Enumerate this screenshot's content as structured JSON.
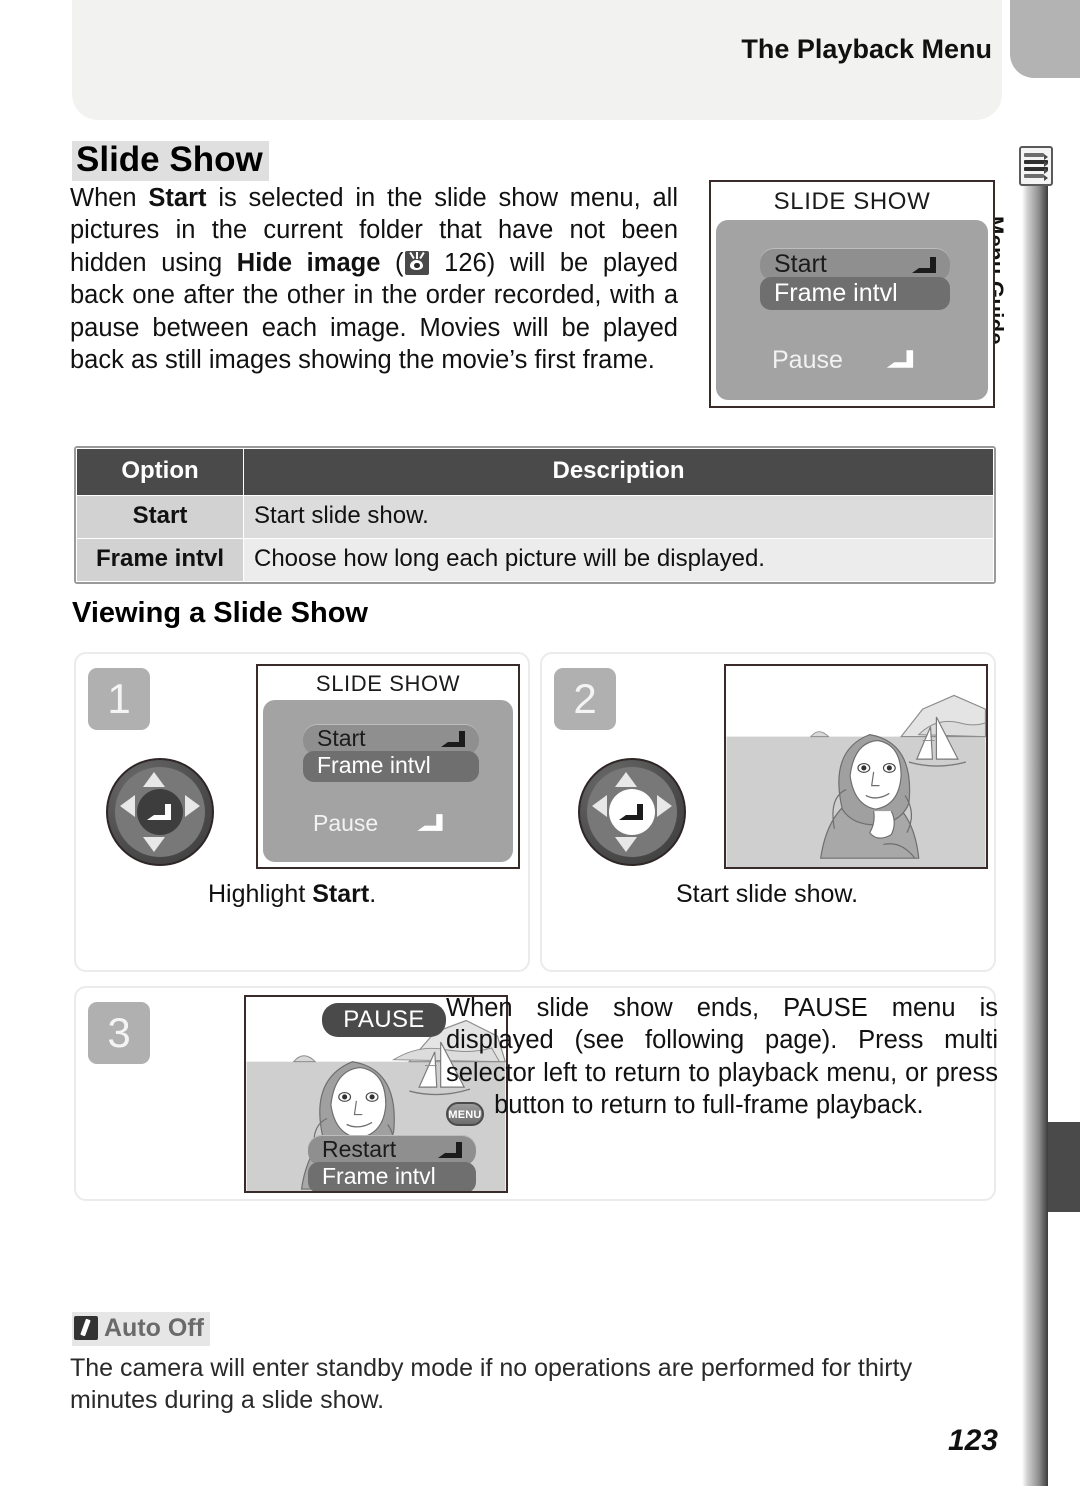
{
  "header": {
    "title": "The Playback Menu"
  },
  "sidebar": {
    "label": "Menu Guide",
    "icon": "menu-list-icon"
  },
  "section": {
    "heading": "Slide Show",
    "intro_parts": {
      "p1": "When ",
      "b1": "Start",
      "p2": " is selected in the slide show menu, all pictures in the current folder that have not been hidden using ",
      "b2": "Hide image",
      "p3": " (",
      "page_ref": "126",
      "p4": ") will be played back one after the other in the order recorded, with a pause between each image.  Movies will be played back as still images showing the movie’s first frame."
    }
  },
  "lcd_top": {
    "title": "SLIDE SHOW",
    "items": [
      {
        "label": "Start",
        "state": "highlighted",
        "glyph": "enter-icon"
      },
      {
        "label": "Frame intvl",
        "state": "selected"
      }
    ],
    "pause_label": "Pause",
    "pause_glyph": "enter-icon"
  },
  "table": {
    "headers": [
      "Option",
      "Description"
    ],
    "rows": [
      {
        "option": "Start",
        "description": "Start slide show."
      },
      {
        "option": "Frame intvl",
        "description": "Choose how long each picture will be displayed."
      }
    ]
  },
  "subsection": {
    "heading": "Viewing a Slide Show"
  },
  "steps": [
    {
      "number": "1",
      "caption_plain": "Highlight ",
      "caption_bold": "Start",
      "caption_tail": ".",
      "lcd": {
        "title": "SLIDE SHOW",
        "items": [
          {
            "label": "Start",
            "state": "highlighted",
            "glyph": "enter-icon"
          },
          {
            "label": "Frame intvl",
            "state": "selected"
          }
        ],
        "pause_label": "Pause",
        "pause_glyph": "enter-icon"
      },
      "control": "multi-selector"
    },
    {
      "number": "2",
      "caption_plain": "Start slide show.",
      "caption_bold": "",
      "caption_tail": "",
      "control": "multi-selector"
    },
    {
      "number": "3",
      "lcd": {
        "badge": "PAUSE",
        "items": [
          {
            "label": "Restart",
            "state": "highlighted",
            "glyph": "enter-icon"
          },
          {
            "label": "Frame intvl",
            "state": "selected"
          }
        ]
      },
      "body_parts": {
        "t1": "When slide show ends, PAUSE menu is displayed (see following page).  Press multi selector left to return to playback menu, or press ",
        "btn": "MENU",
        "t2": " button to return to full-frame playback."
      }
    }
  ],
  "note": {
    "title": "Auto Off",
    "icon": "pencil-icon",
    "body": "The camera will enter standby mode if no operations are performed for thirty minutes during a slide show."
  },
  "page_number": "123",
  "colors": {
    "header_band": "#f2f2f0",
    "corner_tab": "#b3b3b3",
    "table_header": "#4a4a4a",
    "heading_highlight": "#dfdfdf",
    "lcd_body": "#a3a3a3",
    "step_number": "#b0b0b0"
  }
}
